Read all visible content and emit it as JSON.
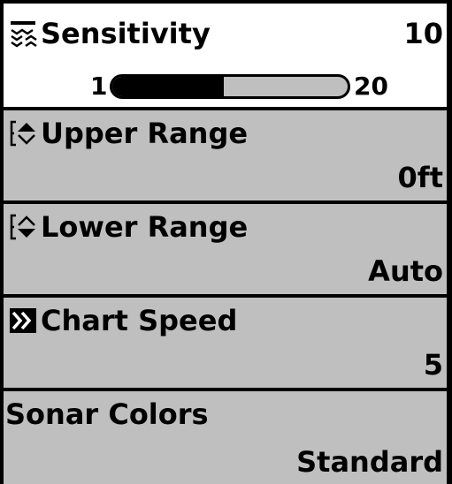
{
  "menu": {
    "sensitivity": {
      "icon": "sensitivity-icon",
      "label": "Sensitivity",
      "value": "10",
      "slider": {
        "min": "1",
        "max": "20",
        "level": 10
      }
    },
    "upper_range": {
      "icon": "range-arrows-icon",
      "label": "Upper Range",
      "value": "0ft"
    },
    "lower_range": {
      "icon": "range-arrows-icon",
      "label": "Lower Range",
      "value": "Auto"
    },
    "chart_speed": {
      "icon": "chart-speed-icon",
      "label": "Chart Speed",
      "value": "5"
    },
    "sonar_colors": {
      "label": "Sonar Colors",
      "value": "Standard"
    }
  },
  "colors": {
    "selected_bg": "#ffffff",
    "unselected_bg": "#bfbfbf",
    "border": "#000000"
  }
}
